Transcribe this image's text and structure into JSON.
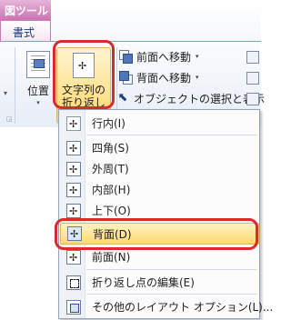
{
  "context_tab": "図ツール",
  "ribbon": {
    "active_tab": "書式",
    "position_label": "位置",
    "wrap_text_label_line1": "文字列の",
    "wrap_text_label_line2": "折り返し",
    "bring_forward_label": "前面へ移動",
    "send_backward_label": "背面へ移動",
    "selection_pane_label": "オブジェクトの選択と表示"
  },
  "wrap_menu": {
    "items": [
      {
        "label": "行内(I)",
        "icon": "inline-wrap-icon"
      },
      {
        "label": "四角(S)",
        "icon": "square-wrap-icon"
      },
      {
        "label": "外周(T)",
        "icon": "tight-wrap-icon"
      },
      {
        "label": "内部(H)",
        "icon": "through-wrap-icon"
      },
      {
        "label": "上下(O)",
        "icon": "top-bottom-wrap-icon"
      },
      {
        "label": "背面(D)",
        "icon": "behind-text-icon",
        "selected": true
      },
      {
        "label": "前面(N)",
        "icon": "in-front-of-text-icon"
      },
      {
        "label": "折り返し点の編集(E)",
        "icon": "edit-wrap-points-icon"
      },
      {
        "label": "その他のレイアウト オプション(L)...",
        "icon": "layout-options-icon"
      }
    ]
  },
  "colors": {
    "highlight": "#d92b2b",
    "selected_fill": "#ffd86e",
    "context_tab": "#c974b2"
  }
}
